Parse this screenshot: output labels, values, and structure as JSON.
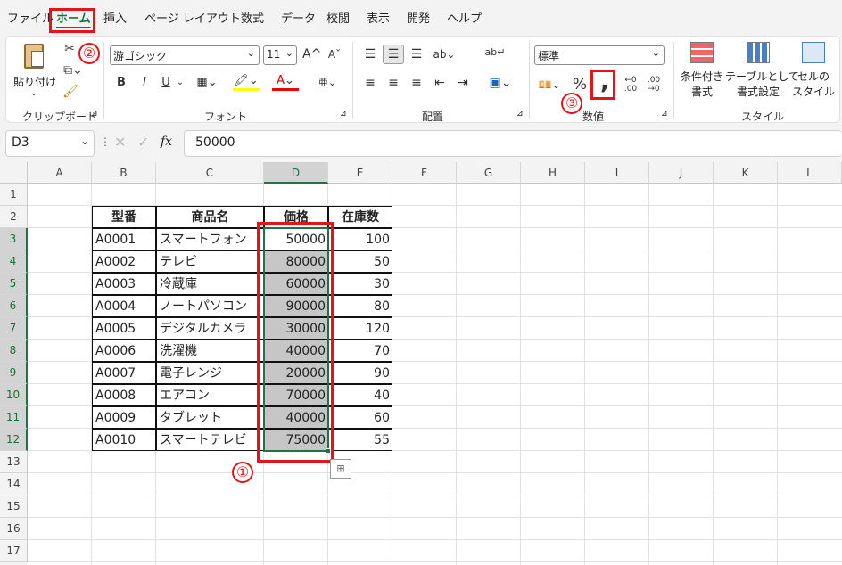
{
  "tabs": [
    "ファイル",
    "ホーム",
    "挿入",
    "ページ レイアウト",
    "数式",
    "データ",
    "校閲",
    "表示",
    "開発",
    "ヘルプ"
  ],
  "clipboard": {
    "paste_label": "貼り付け",
    "group_label": "クリップボード"
  },
  "font": {
    "name": "游ゴシック",
    "size": "11",
    "grow": "A^",
    "shrink": "Aˇ",
    "bold": "B",
    "italic": "I",
    "underline": "U",
    "group_label": "フォント"
  },
  "alignment": {
    "group_label": "配置"
  },
  "number": {
    "format": "標準",
    "percent": "%",
    "comma": ",",
    "group_label": "数値"
  },
  "styles": {
    "conditional": [
      "条件付き",
      "書式"
    ],
    "table": [
      "テーブルとして",
      "書式設定"
    ],
    "cell": [
      "セルの",
      "スタイル"
    ],
    "group_label": "スタイル"
  },
  "formula_bar": {
    "name_box": "D3",
    "fx": "fx",
    "value": "50000"
  },
  "columns": [
    "A",
    "B",
    "C",
    "D",
    "E",
    "F",
    "G",
    "H",
    "I",
    "J",
    "K",
    "L"
  ],
  "rows": [
    "1",
    "2",
    "3",
    "4",
    "5",
    "6",
    "7",
    "8",
    "9",
    "10",
    "11",
    "12",
    "13",
    "14",
    "15",
    "16",
    "17"
  ],
  "table": {
    "headers": [
      "型番",
      "商品名",
      "価格",
      "在庫数"
    ],
    "rows": [
      [
        "A0001",
        "スマートフォン",
        "50000",
        "100"
      ],
      [
        "A0002",
        "テレビ",
        "80000",
        "50"
      ],
      [
        "A0003",
        "冷蔵庫",
        "60000",
        "30"
      ],
      [
        "A0004",
        "ノートパソコン",
        "90000",
        "80"
      ],
      [
        "A0005",
        "デジタルカメラ",
        "30000",
        "120"
      ],
      [
        "A0006",
        "洗濯機",
        "40000",
        "70"
      ],
      [
        "A0007",
        "電子レンジ",
        "20000",
        "90"
      ],
      [
        "A0008",
        "エアコン",
        "70000",
        "40"
      ],
      [
        "A0009",
        "タブレット",
        "40000",
        "60"
      ],
      [
        "A0010",
        "スマートテレビ",
        "75000",
        "55"
      ]
    ]
  },
  "annotations": [
    "①",
    "②",
    "③"
  ],
  "colors": {
    "accent_green": "#217346",
    "annotation_red": "#e3141a",
    "selection_gray": "#c6c6c6"
  }
}
